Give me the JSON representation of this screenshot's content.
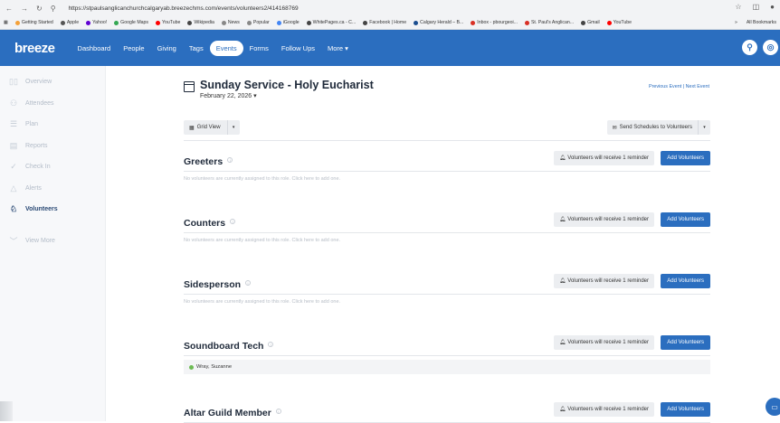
{
  "browser": {
    "url": "https://stpaulsanglicanchurchcalgaryab.breezechms.com/events/volunteers2/414168769",
    "bookmarks": [
      {
        "label": "Getting Started",
        "color": "#f4a13a"
      },
      {
        "label": "Apple",
        "color": "#555555"
      },
      {
        "label": "Yahoo!",
        "color": "#6001d2"
      },
      {
        "label": "Google Maps",
        "color": "#34a853"
      },
      {
        "label": "YouTube",
        "color": "#ff0000"
      },
      {
        "label": "Wikipedia",
        "color": "#444444"
      },
      {
        "label": "News",
        "color": "#888888"
      },
      {
        "label": "Popular",
        "color": "#888888"
      },
      {
        "label": "iGoogle",
        "color": "#4285f4"
      },
      {
        "label": "WhitePages.ca - C...",
        "color": "#444444"
      },
      {
        "label": "Facebook | Home",
        "color": "#444444"
      },
      {
        "label": "Calgary Herald – B...",
        "color": "#1a4d8f"
      },
      {
        "label": "Inbox - pbourgeoi...",
        "color": "#d93025"
      },
      {
        "label": "St. Paul's Anglican...",
        "color": "#d93025"
      },
      {
        "label": "Gmail",
        "color": "#444444"
      },
      {
        "label": "YouTube",
        "color": "#ff0000"
      }
    ],
    "all_bookmarks": "All Bookmarks"
  },
  "topnav": {
    "logo": "breeze",
    "items": [
      "Dashboard",
      "People",
      "Giving",
      "Tags",
      "Events",
      "Forms",
      "Follow Ups",
      "More ▾"
    ],
    "active": "Events",
    "brand_color": "#2b6ebf"
  },
  "sidebar": {
    "items": [
      {
        "label": "Overview",
        "icon": "overview-icon"
      },
      {
        "label": "Attendees",
        "icon": "person-icon"
      },
      {
        "label": "Plan",
        "icon": "list-icon"
      },
      {
        "label": "Reports",
        "icon": "report-icon"
      },
      {
        "label": "Check In",
        "icon": "check-icon"
      },
      {
        "label": "Alerts",
        "icon": "bell-icon"
      },
      {
        "label": "Volunteers",
        "icon": "volunteer-icon"
      }
    ],
    "active": "Volunteers",
    "view_more": "View More"
  },
  "event": {
    "title": "Sunday Service - Holy Eucharist",
    "date": "February 22, 2026 ▾",
    "links": "Previous Event | Next Event"
  },
  "toolbar": {
    "grid_view": "Grid View",
    "send_schedules": "Send Schedules to Volunteers"
  },
  "roles": [
    {
      "name": "Greeters",
      "reminder": "Volunteers will receive 1 reminder",
      "add": "Add Volunteers",
      "empty": "No volunteers are currently assigned to this role. Click here to add one.",
      "assignees": []
    },
    {
      "name": "Counters",
      "reminder": "Volunteers will receive 1 reminder",
      "add": "Add Volunteers",
      "empty": "No volunteers are currently assigned to this role. Click here to add one.",
      "assignees": []
    },
    {
      "name": "Sidesperson",
      "reminder": "Volunteers will receive 1 reminder",
      "add": "Add Volunteers",
      "empty": "No volunteers are currently assigned to this role. Click here to add one.",
      "assignees": []
    },
    {
      "name": "Soundboard Tech",
      "reminder": "Volunteers will receive 1 reminder",
      "add": "Add Volunteers",
      "empty": "",
      "assignees": [
        "Wray, Suzanne"
      ]
    },
    {
      "name": "Altar Guild Member",
      "reminder": "Volunteers will receive 1 reminder",
      "add": "Add Volunteers",
      "empty": "",
      "assignees": []
    }
  ]
}
